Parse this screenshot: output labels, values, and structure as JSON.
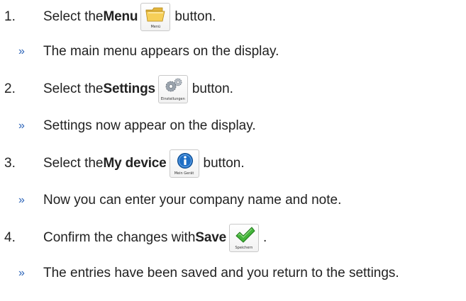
{
  "steps": [
    {
      "number": "1.",
      "before": "Select the ",
      "keyword": "Menu",
      "after": " button.",
      "button_caption": "Menü",
      "icon": "folder-icon",
      "result": "The main menu appears on the display."
    },
    {
      "number": "2.",
      "before": "Select the ",
      "keyword": "Settings",
      "after": " button.",
      "button_caption": "Einstellungen",
      "icon": "gears-icon",
      "result": "Settings now appear on the display."
    },
    {
      "number": "3.",
      "before": "Select the ",
      "keyword": "My device",
      "after": " button.",
      "button_caption": "Mein Gerät",
      "icon": "info-icon",
      "result": "Now you can enter your company name and note."
    },
    {
      "number": "4.",
      "before": "Confirm the changes with ",
      "keyword": "Save",
      "after": ".",
      "button_caption": "Speichern",
      "icon": "checkmark-icon",
      "result": "The entries have been saved and you return to the settings."
    }
  ],
  "result_marker": "»",
  "colors": {
    "text": "#222222",
    "marker": "#2b63b8",
    "folder": "#f2c94c",
    "info": "#1f6fc5",
    "check": "#39a935"
  }
}
